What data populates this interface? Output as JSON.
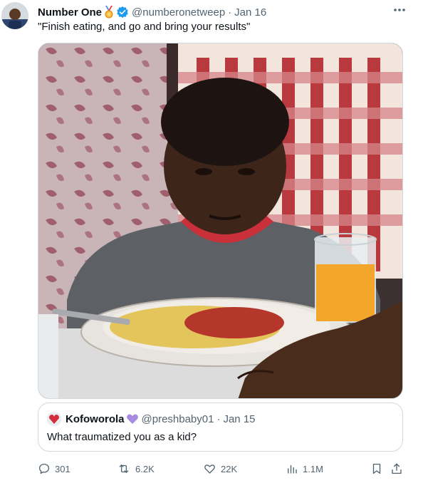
{
  "tweet": {
    "author_name": "Number One",
    "author_handle": "@numberonetweep",
    "separator": "·",
    "date": "Jan 16",
    "text": "\"Finish eating, and go and bring your results\"",
    "media_alt": "Boy sitting at a dining table with a plate of spaghetti and a glass of orange juice"
  },
  "quoted": {
    "author_name": "Kofoworola",
    "author_handle": "@preshbaby01",
    "separator": "·",
    "date": "Jan 15",
    "text": "What traumatized you as a kid?"
  },
  "actions": {
    "replies": "301",
    "reposts": "6.2K",
    "likes": "22K",
    "views": "1.1M"
  },
  "colors": {
    "text_primary": "#0f1419",
    "text_secondary": "#536471",
    "verified_blue": "#1d9bf0",
    "border": "#cfd9de",
    "heart_purple": "#a78be0"
  },
  "icons": [
    "medal-icon",
    "verified-icon",
    "more-icon",
    "reply-icon",
    "retweet-icon",
    "like-icon",
    "views-icon",
    "bookmark-icon",
    "share-icon"
  ]
}
